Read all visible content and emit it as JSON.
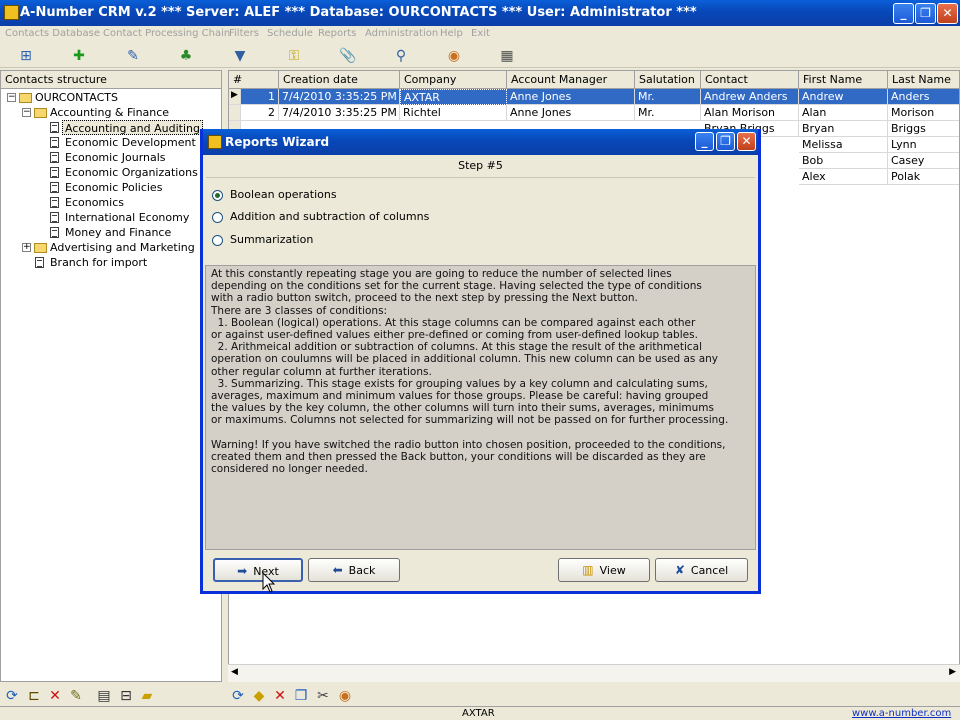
{
  "app": {
    "title": "A-Number CRM v.2 *** Server: ALEF *** Database: OURCONTACTS *** User: Administrator ***",
    "window_buttons": {
      "minimize": "_",
      "maximize": "❐",
      "close": "✕"
    }
  },
  "menu": {
    "items": [
      "Contacts Database",
      "Contact Processing Chain",
      "Filters",
      "Schedule",
      "Reports",
      "Administration",
      "Help",
      "Exit"
    ]
  },
  "toolbar": {
    "icons": [
      "tree-icon",
      "add-icon",
      "edit-icon",
      "hierarchy-icon",
      "filter-icon",
      "keys-icon",
      "attachment-icon",
      "search-icon",
      "database-icon",
      "calculator-icon"
    ]
  },
  "tree": {
    "header": "Contacts structure",
    "root": "OURCONTACTS",
    "group1": "Accounting & Finance",
    "children": [
      "Accounting and Auditing",
      "Economic Development",
      "Economic Journals",
      "Economic Organizations",
      "Economic Policies",
      "Economics",
      "International Economy",
      "Money and Finance"
    ],
    "group2": "Advertising and Marketing",
    "branch": "Branch for import"
  },
  "grid": {
    "columns": [
      "#",
      "Creation date",
      "Company",
      "Account Manager",
      "Salutation",
      "Contact",
      "First Name",
      "Last Name"
    ],
    "rows": [
      [
        "1",
        "7/4/2010 3:35:25 PM",
        "AXTAR",
        "Anne Jones",
        "Mr.",
        "Andrew Anders",
        "Andrew",
        "Anders"
      ],
      [
        "2",
        "7/4/2010 3:35:25 PM",
        "Richtel",
        "Anne Jones",
        "Mr.",
        "Alan Morison",
        "Alan",
        "Morison"
      ],
      [
        "",
        "",
        "",
        "",
        "",
        "Bryan Briggs",
        "Bryan",
        "Briggs"
      ],
      [
        "",
        "",
        "",
        "",
        "",
        "",
        "Melissa",
        "Lynn"
      ],
      [
        "",
        "",
        "",
        "",
        "",
        "",
        "Bob",
        "Casey"
      ],
      [
        "",
        "",
        "",
        "",
        "",
        "",
        "Alex",
        "Polak"
      ]
    ]
  },
  "dialog": {
    "title": "Reports Wizard",
    "step": "Step #5",
    "options": [
      "Boolean operations",
      "Addition and subtraction of columns",
      "Summarization"
    ],
    "selected_option": 0,
    "description": "At this constantly repeating stage you are going to reduce the number of selected lines\ndepending on the conditions set for the current stage. Having selected the type of conditions\nwith a radio button switch, proceed to the next step by pressing the Next button.\nThere are 3 classes of conditions:\n  1. Boolean (logical) operations. At this stage columns can be compared against each other\nor against user-defined values either pre-defined or coming from user-defined lookup tables.\n  2. Arithmeical addition or subtraction of columns. At this stage the result of the arithmetical\noperation on coulumns will be placed in additional column. This new column can be used as any\nother regular column at further iterations.\n  3. Summarizing. This stage exists for grouping values by a key column and calculating sums,\naverages, maximum and minimum values for those groups. Please be careful: having grouped\nthe values by the key column, the other columns will turn into their sums, averages, minimums\nor maximums. Columns not selected for summarizing will not be passed on for further processing.\n\nWarning! If you have switched the radio button into chosen position, proceeded to the conditions,\ncreated them and then pressed the Back button, your conditions will be discarded as they are\nconsidered no longer needed.",
    "buttons": {
      "next": "Next",
      "back": "Back",
      "view": "View",
      "cancel": "Cancel"
    }
  },
  "status": {
    "company": "AXTAR",
    "link": "www.a-number.com"
  }
}
